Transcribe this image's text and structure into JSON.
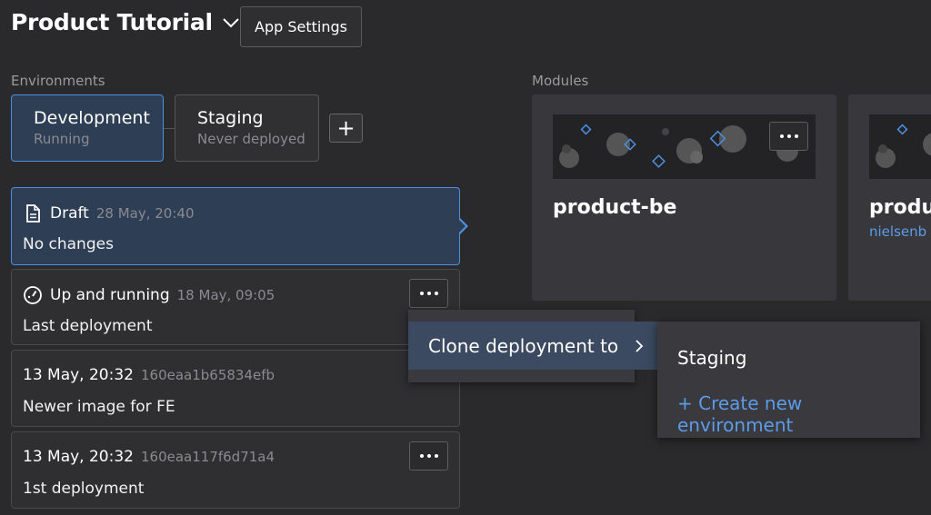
{
  "header": {
    "title": "Product Tutorial",
    "settings_label": "App Settings"
  },
  "environments": {
    "label": "Environments",
    "items": [
      {
        "name": "Development",
        "status": "Running"
      },
      {
        "name": "Staging",
        "status": "Never deployed"
      }
    ],
    "add_label": "+"
  },
  "deployments": [
    {
      "title": "Draft",
      "time": "28 May, 20:40",
      "note": "No changes",
      "icon": "document-icon"
    },
    {
      "title": "Up and running",
      "time": "18 May, 09:05",
      "note": "Last deployment",
      "icon": "running-gauge-icon"
    },
    {
      "title": "13 May, 20:32",
      "hash": "160eaa1b65834efb",
      "note": "Newer image for FE"
    },
    {
      "title": "13 May, 20:32",
      "hash": "160eaa117f6d71a4",
      "note": "1st deployment"
    }
  ],
  "context_menu": {
    "item": "Clone deployment to",
    "submenu": {
      "staging": "Staging",
      "create": "+ Create new environment"
    }
  },
  "modules": {
    "label": "Modules",
    "items": [
      {
        "name": "product-be"
      },
      {
        "name": "produ",
        "owner": "nielsenb"
      }
    ]
  },
  "colors": {
    "accent": "#4d8fe0",
    "link": "#5b9be8",
    "background": "#2a2a2c"
  }
}
